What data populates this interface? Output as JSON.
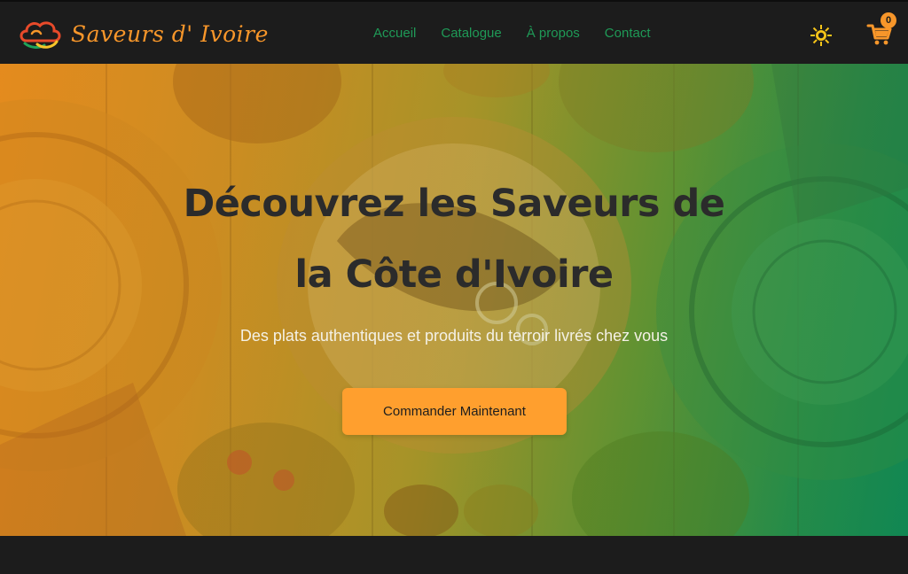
{
  "colors": {
    "accent_orange": "#f7962a",
    "accent_green": "#1f9a57",
    "navbar_bg": "#1c1c1c",
    "cta_bg": "#ff9f2e",
    "title_text": "#2b2b2b"
  },
  "navbar": {
    "brand_name": "Saveurs d' Ivoire",
    "brand_logo_icon": "cloud-logo-icon",
    "links": [
      {
        "label": "Accueil"
      },
      {
        "label": "Catalogue"
      },
      {
        "label": "À propos"
      },
      {
        "label": "Contact"
      }
    ],
    "theme_icon": "sun-icon",
    "cart_icon": "shopping-cart-icon",
    "cart_count": "0"
  },
  "hero": {
    "title_line1": "Découvrez les Saveurs de",
    "title_line2": "la Côte d'Ivoire",
    "subtitle": "Des plats authentiques et produits du terroir livrés chez vous",
    "cta_label": "Commander Maintenant"
  }
}
